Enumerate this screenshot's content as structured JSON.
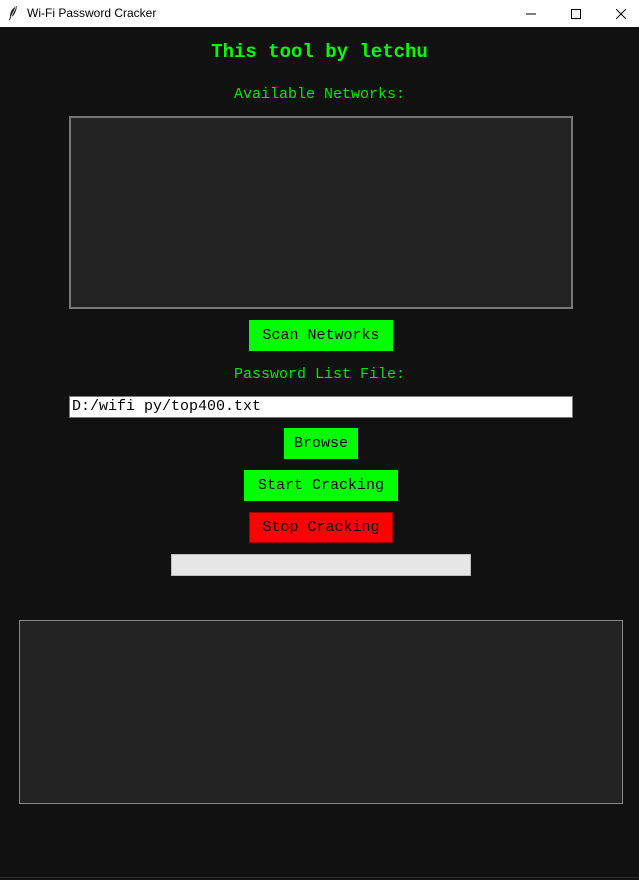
{
  "window": {
    "title": "Wi-Fi Password Cracker",
    "icon": "feather-icon",
    "controls": [
      "minimize-icon",
      "maximize-icon",
      "close-icon"
    ]
  },
  "main": {
    "heading": "This tool by letchu",
    "networks_label": "Available Networks:",
    "networks": [],
    "scan_button": "Scan Networks",
    "password_file_label": "Password List File:",
    "password_file_value": "D:/wifi py/top400.txt",
    "browse_button": "Browse",
    "start_button": "Start Cracking",
    "stop_button": "Stop Cracking",
    "progress_percent": 0,
    "output_text": ""
  },
  "colors": {
    "background": "#111111",
    "accent_green": "#00ff00",
    "stop_red": "#ff0000",
    "panel": "#222222"
  }
}
